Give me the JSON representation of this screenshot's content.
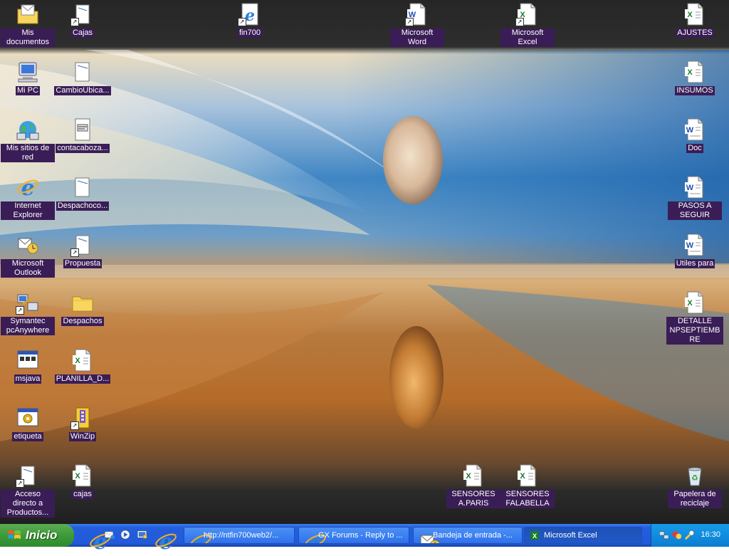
{
  "desktop": {
    "icons": [
      {
        "label": "Mis documentos",
        "icon": "folder-mail-icon"
      },
      {
        "label": "Cajas",
        "icon": "shortcut-file-icon"
      },
      {
        "label": "fin700",
        "icon": "ie-shortcut-icon"
      },
      {
        "label": "Microsoft Word",
        "icon": "word-shortcut-icon"
      },
      {
        "label": "Microsoft Excel",
        "icon": "excel-shortcut-icon"
      },
      {
        "label": "AJUSTES",
        "icon": "excel-file-icon"
      },
      {
        "label": "Mi PC",
        "icon": "computer-icon"
      },
      {
        "label": "CambioUbica...",
        "icon": "generic-file-icon"
      },
      {
        "label": "INSUMOS",
        "icon": "excel-file-icon"
      },
      {
        "label": "Mis sitios de red",
        "icon": "network-places-icon"
      },
      {
        "label": "contacaboza...",
        "icon": "text-file-icon"
      },
      {
        "label": "Doc",
        "icon": "word-file-icon"
      },
      {
        "label": "Internet Explorer",
        "icon": "ie-icon"
      },
      {
        "label": "Despachoco...",
        "icon": "generic-file-icon"
      },
      {
        "label": "PASOS A SEGUIR",
        "icon": "word-file-icon"
      },
      {
        "label": "Microsoft Outlook",
        "icon": "outlook-icon"
      },
      {
        "label": "Propuesta",
        "icon": "shortcut-file-icon"
      },
      {
        "label": "Utiles para",
        "icon": "word-file-icon"
      },
      {
        "label": "Symantec pcAnywhere",
        "icon": "pcanywhere-icon"
      },
      {
        "label": "Despachos",
        "icon": "folder-icon"
      },
      {
        "label": "DETALLE NPSEPTIEMBRE",
        "icon": "excel-file-icon"
      },
      {
        "label": "msjava",
        "icon": "app-window-icon"
      },
      {
        "label": "PLANILLA_D...",
        "icon": "excel-file-icon"
      },
      {
        "label": "etiqueta",
        "icon": "app-gear-icon"
      },
      {
        "label": "WinZip",
        "icon": "winzip-icon"
      },
      {
        "label": "Acceso directo a Productos...",
        "icon": "shortcut-file-icon"
      },
      {
        "label": "cajas",
        "icon": "excel-file-icon"
      },
      {
        "label": "SENSORES A.PARIS",
        "icon": "excel-file-icon"
      },
      {
        "label": "SENSORES FALABELLA",
        "icon": "excel-file-icon"
      },
      {
        "label": "Papelera de reciclaje",
        "icon": "recycle-bin-icon"
      }
    ]
  },
  "taskbar": {
    "start_label": "Inicio",
    "quick_launch": [
      "ie-icon",
      "outlook-express-icon",
      "media-player-icon",
      "show-desktop-icon",
      "ie-icon"
    ],
    "tasks": [
      {
        "label": "http://ntfin700web2/...",
        "icon": "ie-icon"
      },
      {
        "label": "GX Forums - Reply to ...",
        "icon": "ie-icon"
      },
      {
        "label": "Bandeja de entrada -...",
        "icon": "outlook-icon"
      },
      {
        "label": "Microsoft Excel",
        "icon": "excel-icon"
      }
    ],
    "tray_icons": [
      "network-icon",
      "antivirus-icon",
      "tool-icon"
    ],
    "clock": "16:30"
  },
  "colors": {
    "label_bg": "#3a1d56",
    "taskbar_blue": "#245edc",
    "start_green": "#3c9b37",
    "tray_blue": "#0f8de0"
  }
}
